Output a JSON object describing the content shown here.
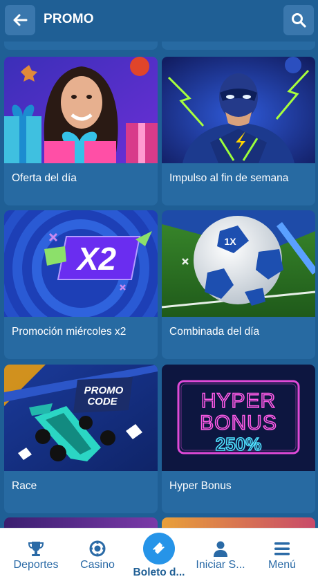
{
  "header": {
    "title": "PROMO",
    "back_icon": "arrow-left-icon",
    "search_icon": "search-icon"
  },
  "promos": [
    {
      "label": "Oferta del día",
      "image": "woman-with-gifts"
    },
    {
      "label": "Impulso al fin de semana",
      "image": "lightning-superhero"
    },
    {
      "label": "Promoción miércoles x2",
      "image": "x2-badge"
    },
    {
      "label": "Combinada del día",
      "image": "soccer-ball"
    },
    {
      "label": "Race",
      "image": "race-car-promo-code"
    },
    {
      "label": "Hyper Bonus",
      "image": "neon-hyper-bonus"
    }
  ],
  "banner_text": {
    "x2": "X2",
    "promo_code_line1": "PROMO",
    "promo_code_line2": "CODE",
    "hyper_line1": "HYPER",
    "hyper_line2": "BONUS",
    "hyper_percent": "250%",
    "ball_logo": "1X"
  },
  "tabbar": {
    "items": [
      {
        "label": "Deportes",
        "icon": "trophy-icon"
      },
      {
        "label": "Casino",
        "icon": "casino-chip-icon"
      },
      {
        "label": "Boleto d...",
        "icon": "ticket-icon",
        "active": true
      },
      {
        "label": "Iniciar S...",
        "icon": "user-icon"
      },
      {
        "label": "Menú",
        "icon": "hamburger-menu-icon"
      }
    ]
  },
  "colors": {
    "background": "#1f5f95",
    "card": "#276aa2",
    "header_button": "#3a77ad",
    "active_tab": "#2694e8",
    "tab_text": "#2a6aa6"
  }
}
